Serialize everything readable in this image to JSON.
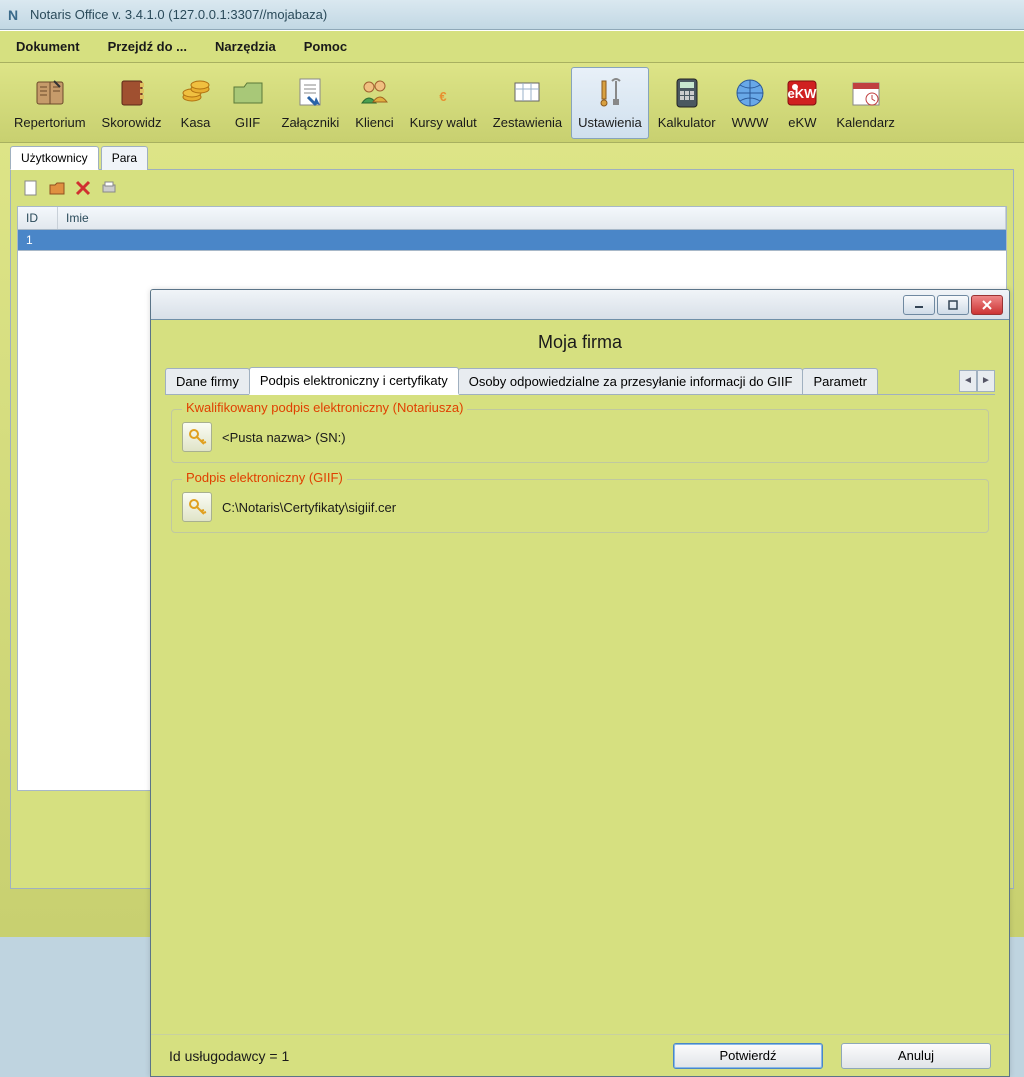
{
  "window": {
    "title": "Notaris Office v. 3.4.1.0 (127.0.0.1:3307//mojabaza)"
  },
  "menu": {
    "dokument": "Dokument",
    "przejdz": "Przejdź do ...",
    "narzedzia": "Narzędzia",
    "pomoc": "Pomoc"
  },
  "toolbar": {
    "repertorium": "Repertorium",
    "skorowidz": "Skorowidz",
    "kasa": "Kasa",
    "giif": "GIIF",
    "zalaczniki": "Załączniki",
    "klienci": "Klienci",
    "kursy": "Kursy walut",
    "zestawienia": "Zestawienia",
    "ustawienia": "Ustawienia",
    "kalkulator": "Kalkulator",
    "www": "WWW",
    "ekw": "eKW",
    "kalendarz": "Kalendarz"
  },
  "back": {
    "tab_uzytkownicy": "Użytkownicy",
    "tab_para": "Para",
    "col_id": "ID",
    "col_imie": "Imie",
    "row1_id": "1"
  },
  "dialog": {
    "title": "Moja firma",
    "tabs": {
      "dane": "Dane firmy",
      "podpis": "Podpis elektroniczny i certyfikaty",
      "osoby": "Osoby odpowiedzialne za przesyłanie informacji do GIIF",
      "parametr": "Parametr"
    },
    "group1_legend": "Kwalifikowany podpis elektroniczny (Notariusza)",
    "group1_value": "<Pusta nazwa> (SN:)",
    "group2_legend": "Podpis elektroniczny (GIIF)",
    "group2_value": "C:\\Notaris\\Certyfikaty\\sigiif.cer",
    "footer_label": "Id usługodawcy = 1",
    "btn_ok": "Potwierdź",
    "btn_cancel": "Anuluj"
  }
}
